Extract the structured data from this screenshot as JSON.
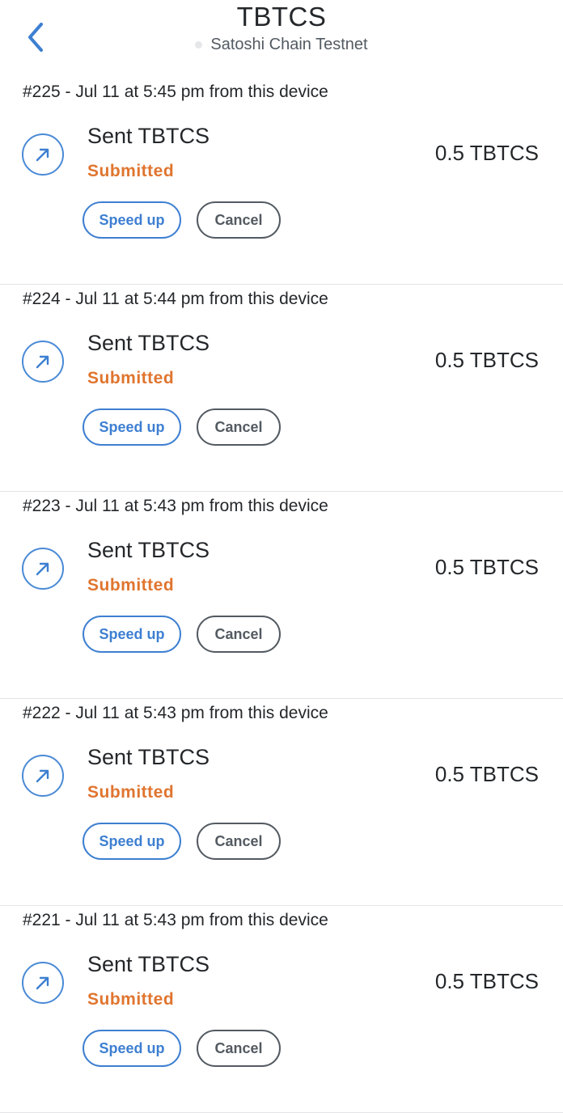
{
  "header": {
    "title": "TBTCS",
    "network": "Satoshi Chain Testnet"
  },
  "colors": {
    "accent": "#3d7fd1",
    "status_submitted": "#e0752f",
    "text_primary": "#24272a",
    "text_secondary": "#535a61"
  },
  "icons": {
    "back": "chevron-left-icon",
    "sent": "arrow-up-right-icon"
  },
  "transactions": [
    {
      "meta": "#225 - Jul 11 at 5:45 pm from this device",
      "type": "Sent TBTCS",
      "status": "Submitted",
      "amount": "0.5 TBTCS",
      "speed_up_label": "Speed up",
      "cancel_label": "Cancel"
    },
    {
      "meta": "#224 - Jul 11 at 5:44 pm from this device",
      "type": "Sent TBTCS",
      "status": "Submitted",
      "amount": "0.5 TBTCS",
      "speed_up_label": "Speed up",
      "cancel_label": "Cancel"
    },
    {
      "meta": "#223 - Jul 11 at 5:43 pm from this device",
      "type": "Sent TBTCS",
      "status": "Submitted",
      "amount": "0.5 TBTCS",
      "speed_up_label": "Speed up",
      "cancel_label": "Cancel"
    },
    {
      "meta": "#222 - Jul 11 at 5:43 pm from this device",
      "type": "Sent TBTCS",
      "status": "Submitted",
      "amount": "0.5 TBTCS",
      "speed_up_label": "Speed up",
      "cancel_label": "Cancel"
    },
    {
      "meta": "#221 - Jul 11 at 5:43 pm from this device",
      "type": "Sent TBTCS",
      "status": "Submitted",
      "amount": "0.5 TBTCS",
      "speed_up_label": "Speed up",
      "cancel_label": "Cancel"
    }
  ]
}
